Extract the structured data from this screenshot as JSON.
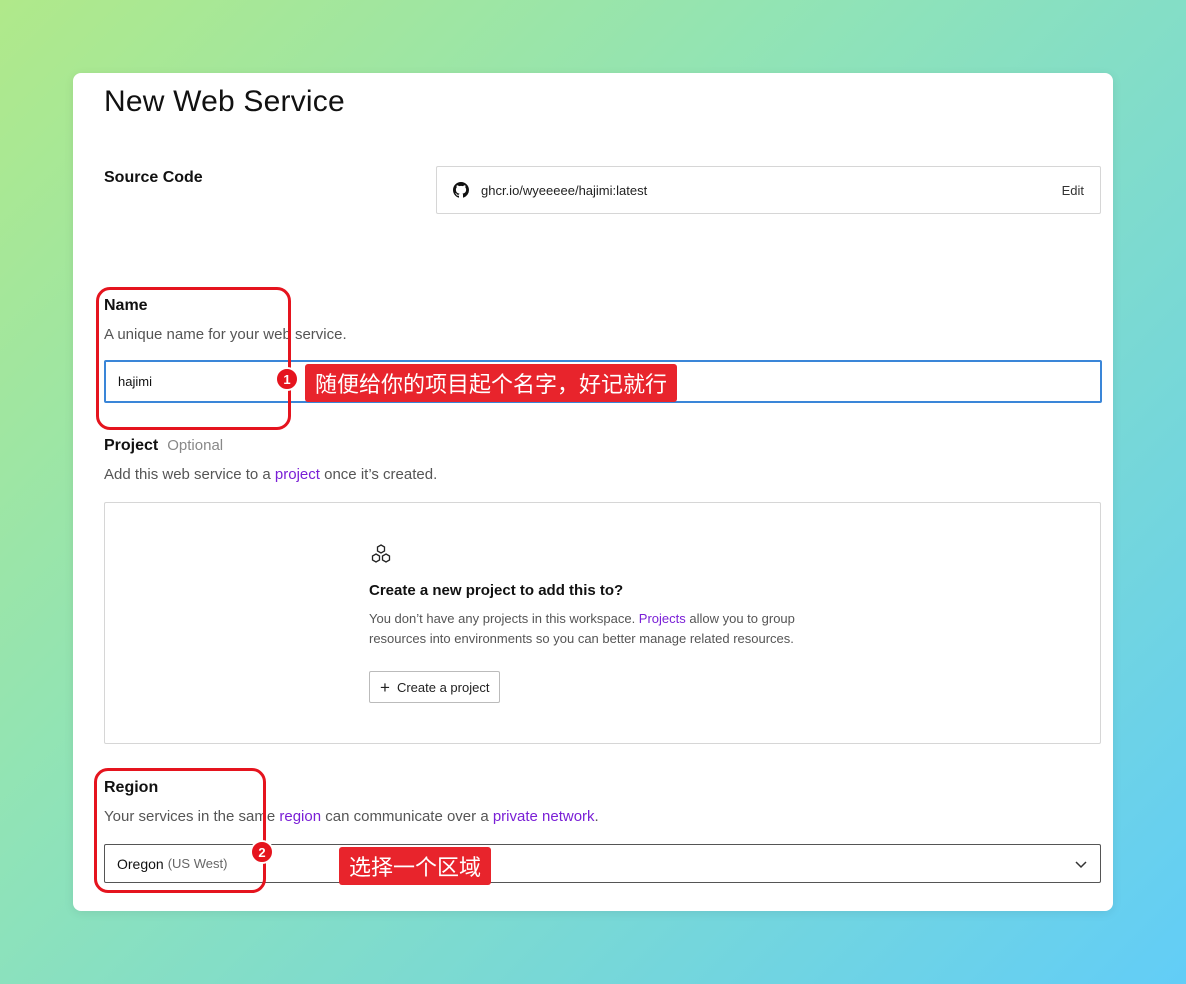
{
  "page_title": "New Web Service",
  "source": {
    "label": "Source Code",
    "url": "ghcr.io/wyeeeee/hajimi:latest",
    "edit_label": "Edit",
    "icon": "github-icon"
  },
  "name": {
    "label": "Name",
    "description": "A unique name for your web service.",
    "value": "hajimi"
  },
  "project": {
    "label": "Project",
    "optional_label": "Optional",
    "desc_before": "Add this web service to a ",
    "desc_link": "project",
    "desc_after": " once it’s created.",
    "empty_title": "Create a new project to add this to?",
    "empty_text_before": "You don’t have any projects in this workspace. ",
    "empty_text_link": "Projects",
    "empty_text_after": " allow you to group resources into environments so you can better manage related resources.",
    "create_button_label": "Create a project"
  },
  "region": {
    "label": "Region",
    "desc_before": "Your services in the same ",
    "desc_link1": "region",
    "desc_middle": " can communicate over a ",
    "desc_link2": "private network",
    "desc_after": ".",
    "selected_name": "Oregon",
    "selected_sub": "(US West)"
  },
  "annotations": [
    {
      "number": "1",
      "text": "随便给你的项目起个名字，好记就行"
    },
    {
      "number": "2",
      "text": "选择一个区域"
    }
  ],
  "colors": {
    "accent_link": "#7a1fd6",
    "focus_border": "#3a86d8",
    "annotation_red": "#e5141e"
  }
}
